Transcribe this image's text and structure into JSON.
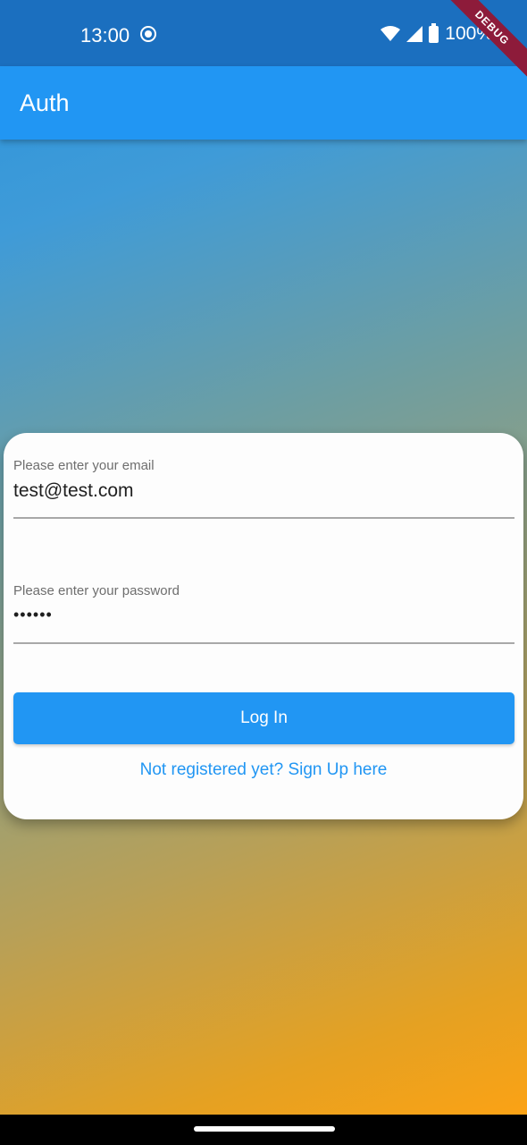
{
  "status_bar": {
    "time": "13:00",
    "battery": "100%",
    "icons": [
      "screen-record-icon",
      "wifi-icon",
      "signal-icon",
      "battery-icon"
    ]
  },
  "debug_banner": "DEBUG",
  "app_bar": {
    "title": "Auth"
  },
  "form": {
    "email": {
      "label": "Please enter your email",
      "value": "test@test.com"
    },
    "password": {
      "label": "Please enter your password",
      "value": "••••••"
    },
    "login_label": "Log In",
    "signup_label": "Not registered yet? Sign Up here"
  },
  "colors": {
    "primary": "#2196f3",
    "status_bar": "#1b6fbf",
    "gradient_start": "#2196f3",
    "gradient_end": "#ffa000"
  }
}
